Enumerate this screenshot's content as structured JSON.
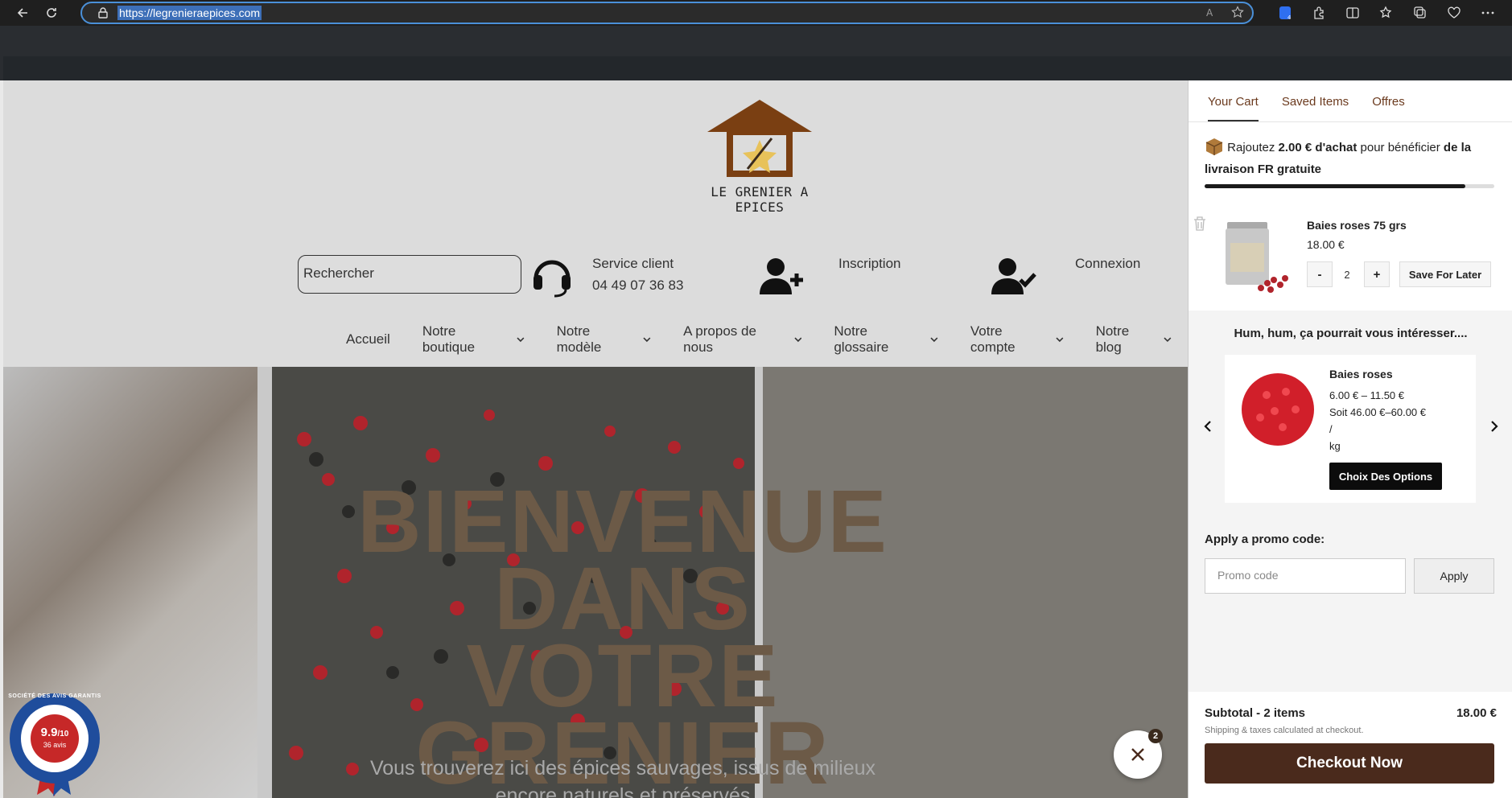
{
  "browser": {
    "url": "https://legrenieraepices.com"
  },
  "site": {
    "logo_text": "LE GRENIER A EPICES",
    "search_placeholder": "Rechercher",
    "service": {
      "title": "Service client",
      "phone": "04 49 07 36 83"
    },
    "inscription": "Inscription",
    "connexion": "Connexion",
    "menu": [
      {
        "label": "Accueil",
        "has_dropdown": false,
        "active": true
      },
      {
        "label": "Notre boutique",
        "has_dropdown": true
      },
      {
        "label": "Notre modèle",
        "has_dropdown": true
      },
      {
        "label": "A propos de nous",
        "has_dropdown": true
      },
      {
        "label": "Notre glossaire",
        "has_dropdown": true
      },
      {
        "label": "Votre compte",
        "has_dropdown": true
      },
      {
        "label": "Notre blog",
        "has_dropdown": true
      }
    ],
    "hero": {
      "title_line1": "BIENVENUE",
      "title_line2": "DANS VOTRE",
      "title_line3": "GRENIER",
      "subtitle_line1": "Vous trouverez ici des épices sauvages, issus de milieux",
      "subtitle_line2": "encore naturels et préservés"
    },
    "badge": {
      "score": "9.9",
      "scale": "/10",
      "reviews": "36 avis",
      "ring_text": "SOCIÉTÉ DES AVIS GARANTIS"
    },
    "fab_count": "2"
  },
  "cart": {
    "tabs": [
      "Your Cart",
      "Saved Items",
      "Offres"
    ],
    "shipping": {
      "prefix": "Rajoutez ",
      "amount": "2.00 € d'achat",
      "middle": " pour bénéficier ",
      "suffix": "de la livraison FR gratuite",
      "progress": 0.9
    },
    "item": {
      "name": "Baies roses 75 grs",
      "price": "18.00 €",
      "qty": "2",
      "minus": "-",
      "plus": "+",
      "save_later": "Save For Later"
    },
    "upsell": {
      "title": "Hum, hum, ça pourrait vous intéresser....",
      "name": "Baies roses",
      "price_range": "6.00 € – 11.50 €",
      "per_kg_1": "Soit 46.00 €–60.00 €",
      "per_kg_2": "/",
      "per_kg_3": "kg",
      "button": "Choix Des Options"
    },
    "promo": {
      "label": "Apply a promo code:",
      "placeholder": "Promo code",
      "button": "Apply"
    },
    "footer": {
      "subtotal_label": "Subtotal - 2 items",
      "subtotal_value": "18.00 €",
      "note": "Shipping & taxes calculated at checkout.",
      "checkout": "Checkout Now"
    }
  },
  "colors": {
    "brand_brown": "#4a2a1c",
    "tab_text": "#6b3a1e",
    "hero_title": "#6c5a47"
  }
}
